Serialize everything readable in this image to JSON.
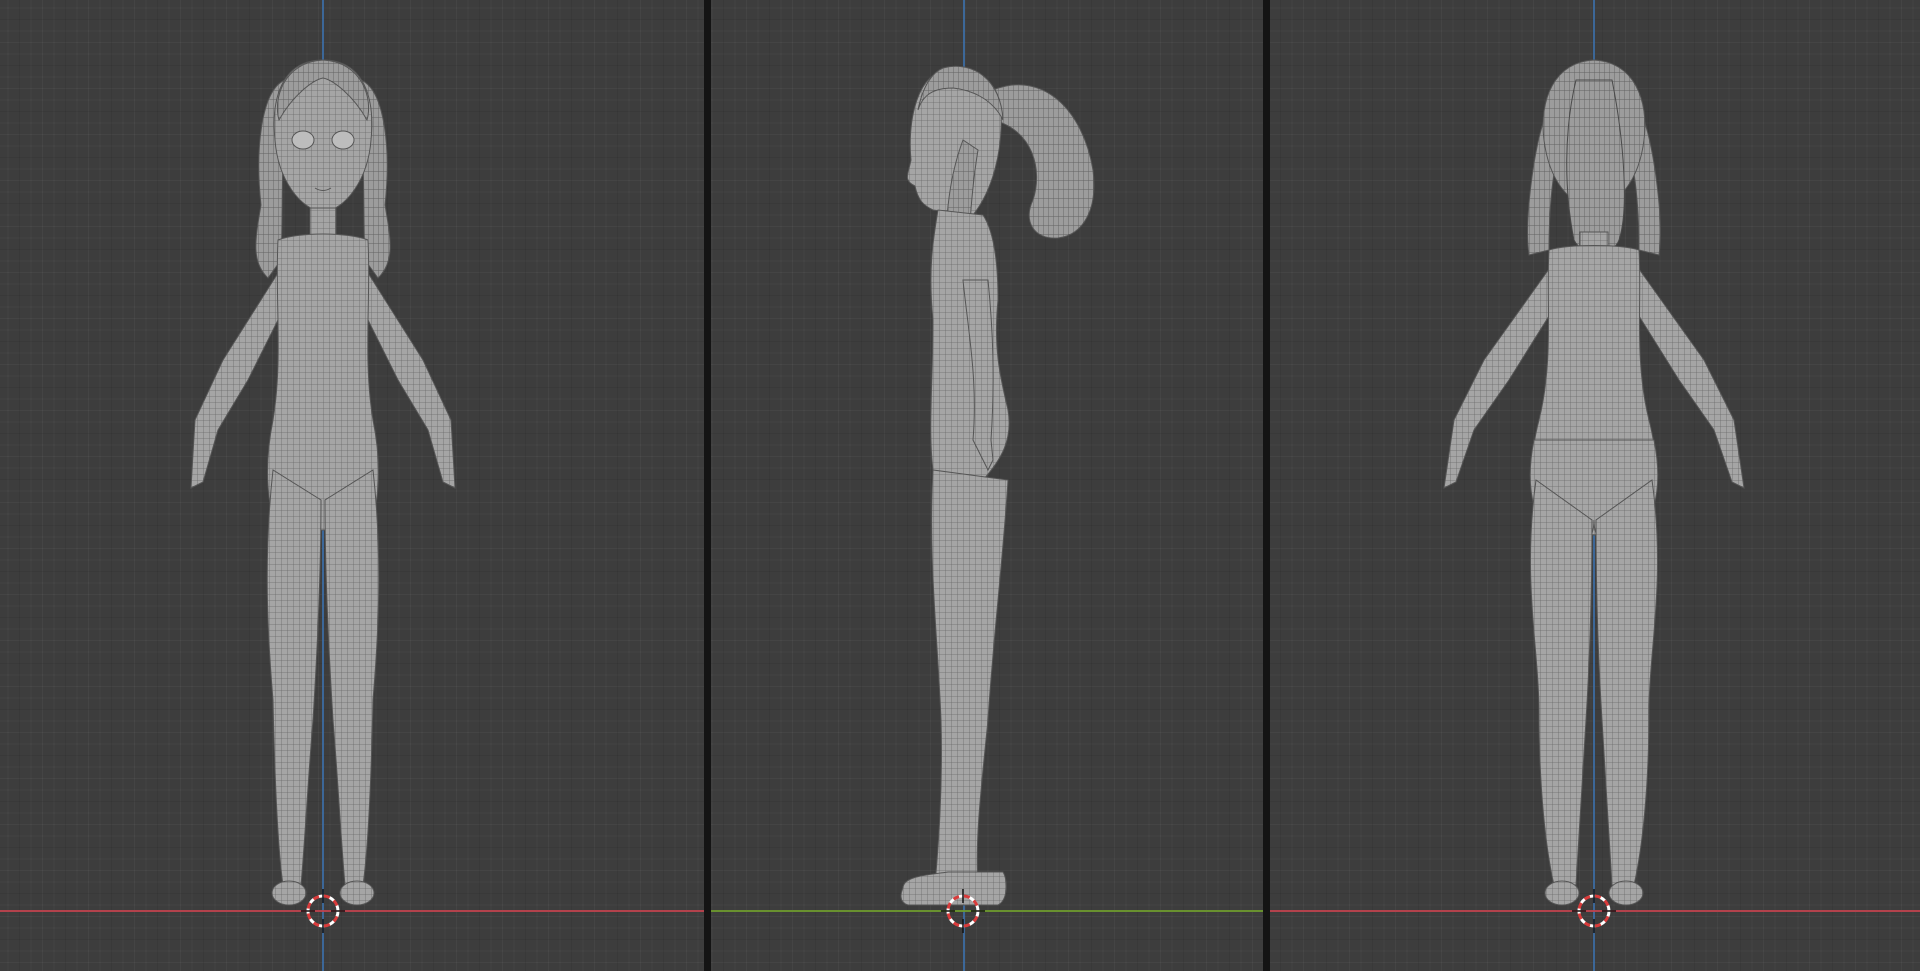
{
  "viewports": [
    {
      "id": "front",
      "view": "front-orthographic",
      "x_axis_color": "#c0424e",
      "z_axis_color": "#3c6fa8"
    },
    {
      "id": "side",
      "view": "side-orthographic",
      "y_axis_color": "#6e9a2e",
      "z_axis_color": "#3c6fa8"
    },
    {
      "id": "back",
      "view": "back-orthographic",
      "x_axis_color": "#c0424e",
      "z_axis_color": "#3c6fa8"
    }
  ],
  "icons": {
    "cursor": "3d-cursor-icon",
    "model": "wireframe-character-mesh"
  },
  "colors": {
    "grid_background": "#3d3d3d",
    "mesh_fill": "#a3a3a3",
    "divider": "#141414",
    "cursor_red": "#d93b3b"
  }
}
